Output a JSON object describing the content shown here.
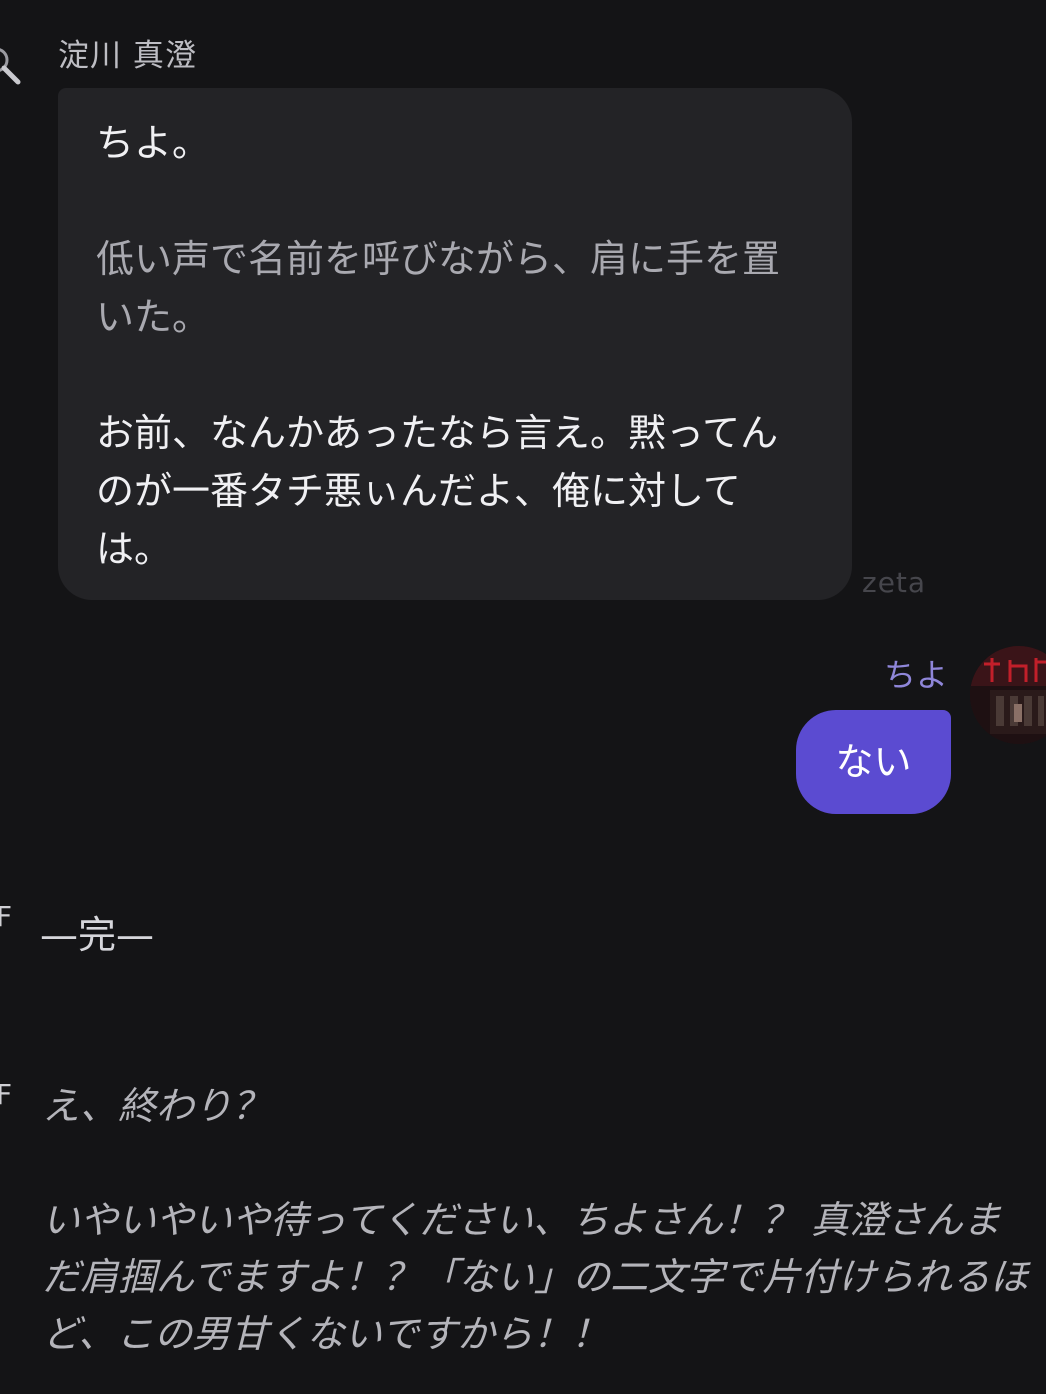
{
  "character": {
    "name": "淀川 真澄",
    "icon": "magnifier-avatar-icon"
  },
  "incoming_message": {
    "line1": "ちよ。",
    "narration": "低い声で名前を呼びながら、肩に手を置いた。",
    "line3": "お前、なんかあったなら言え。黙ってんのが一番タチ悪ぃんだよ、俺に対しては。"
  },
  "platform_tag": "zeta",
  "user": {
    "name": "ちよ",
    "avatar_icon": "user-avatar-icon"
  },
  "outgoing_message": "ない",
  "end_section": {
    "marker": "F",
    "text": "—完—"
  },
  "assistant_note": {
    "marker": "F",
    "line1": "え、終わり？",
    "line2": "いやいやいや待ってください、ちよさん！？ 真澄さんまだ肩掴んでますよ！？「ない」の二文字で片付けられるほど、この男甘くないですから！！"
  },
  "colors": {
    "background": "#141416",
    "incoming_bubble": "#232326",
    "outgoing_bubble": "#5b4bd1",
    "user_name": "#8f86d9"
  }
}
